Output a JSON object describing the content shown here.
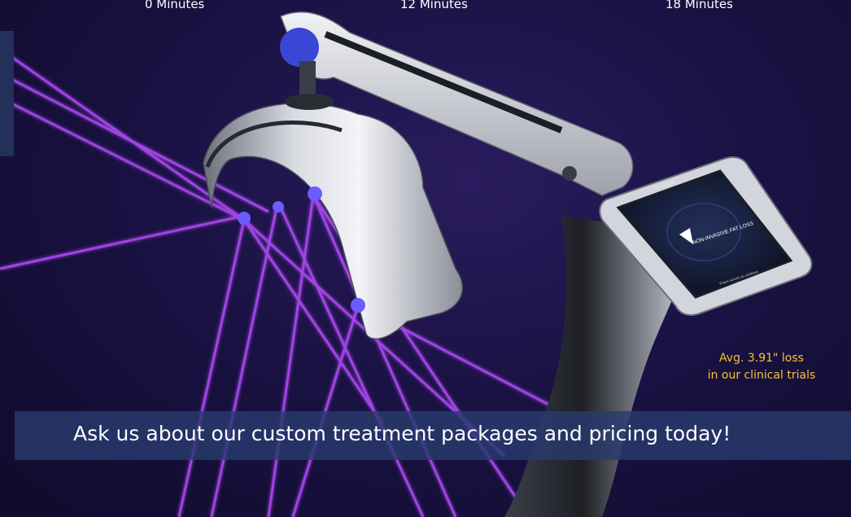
{
  "timeline": {
    "labels": [
      "0 Minutes",
      "12 Minutes",
      "18 Minutes"
    ]
  },
  "device_screen": {
    "brand": "Erchonia",
    "title": "NON-INVASIVE FAT LOSS",
    "prompt": "Press screen to continue"
  },
  "stat": {
    "line1": "Avg. 3.91\" loss",
    "line2": "in our clinical trials"
  },
  "banner": {
    "text": "Ask us about our custom treatment packages and pricing today!"
  },
  "colors": {
    "background": "#1a1244",
    "laser": "#b84dff",
    "accent_yellow": "#f6c531",
    "banner": "#283a6e"
  }
}
